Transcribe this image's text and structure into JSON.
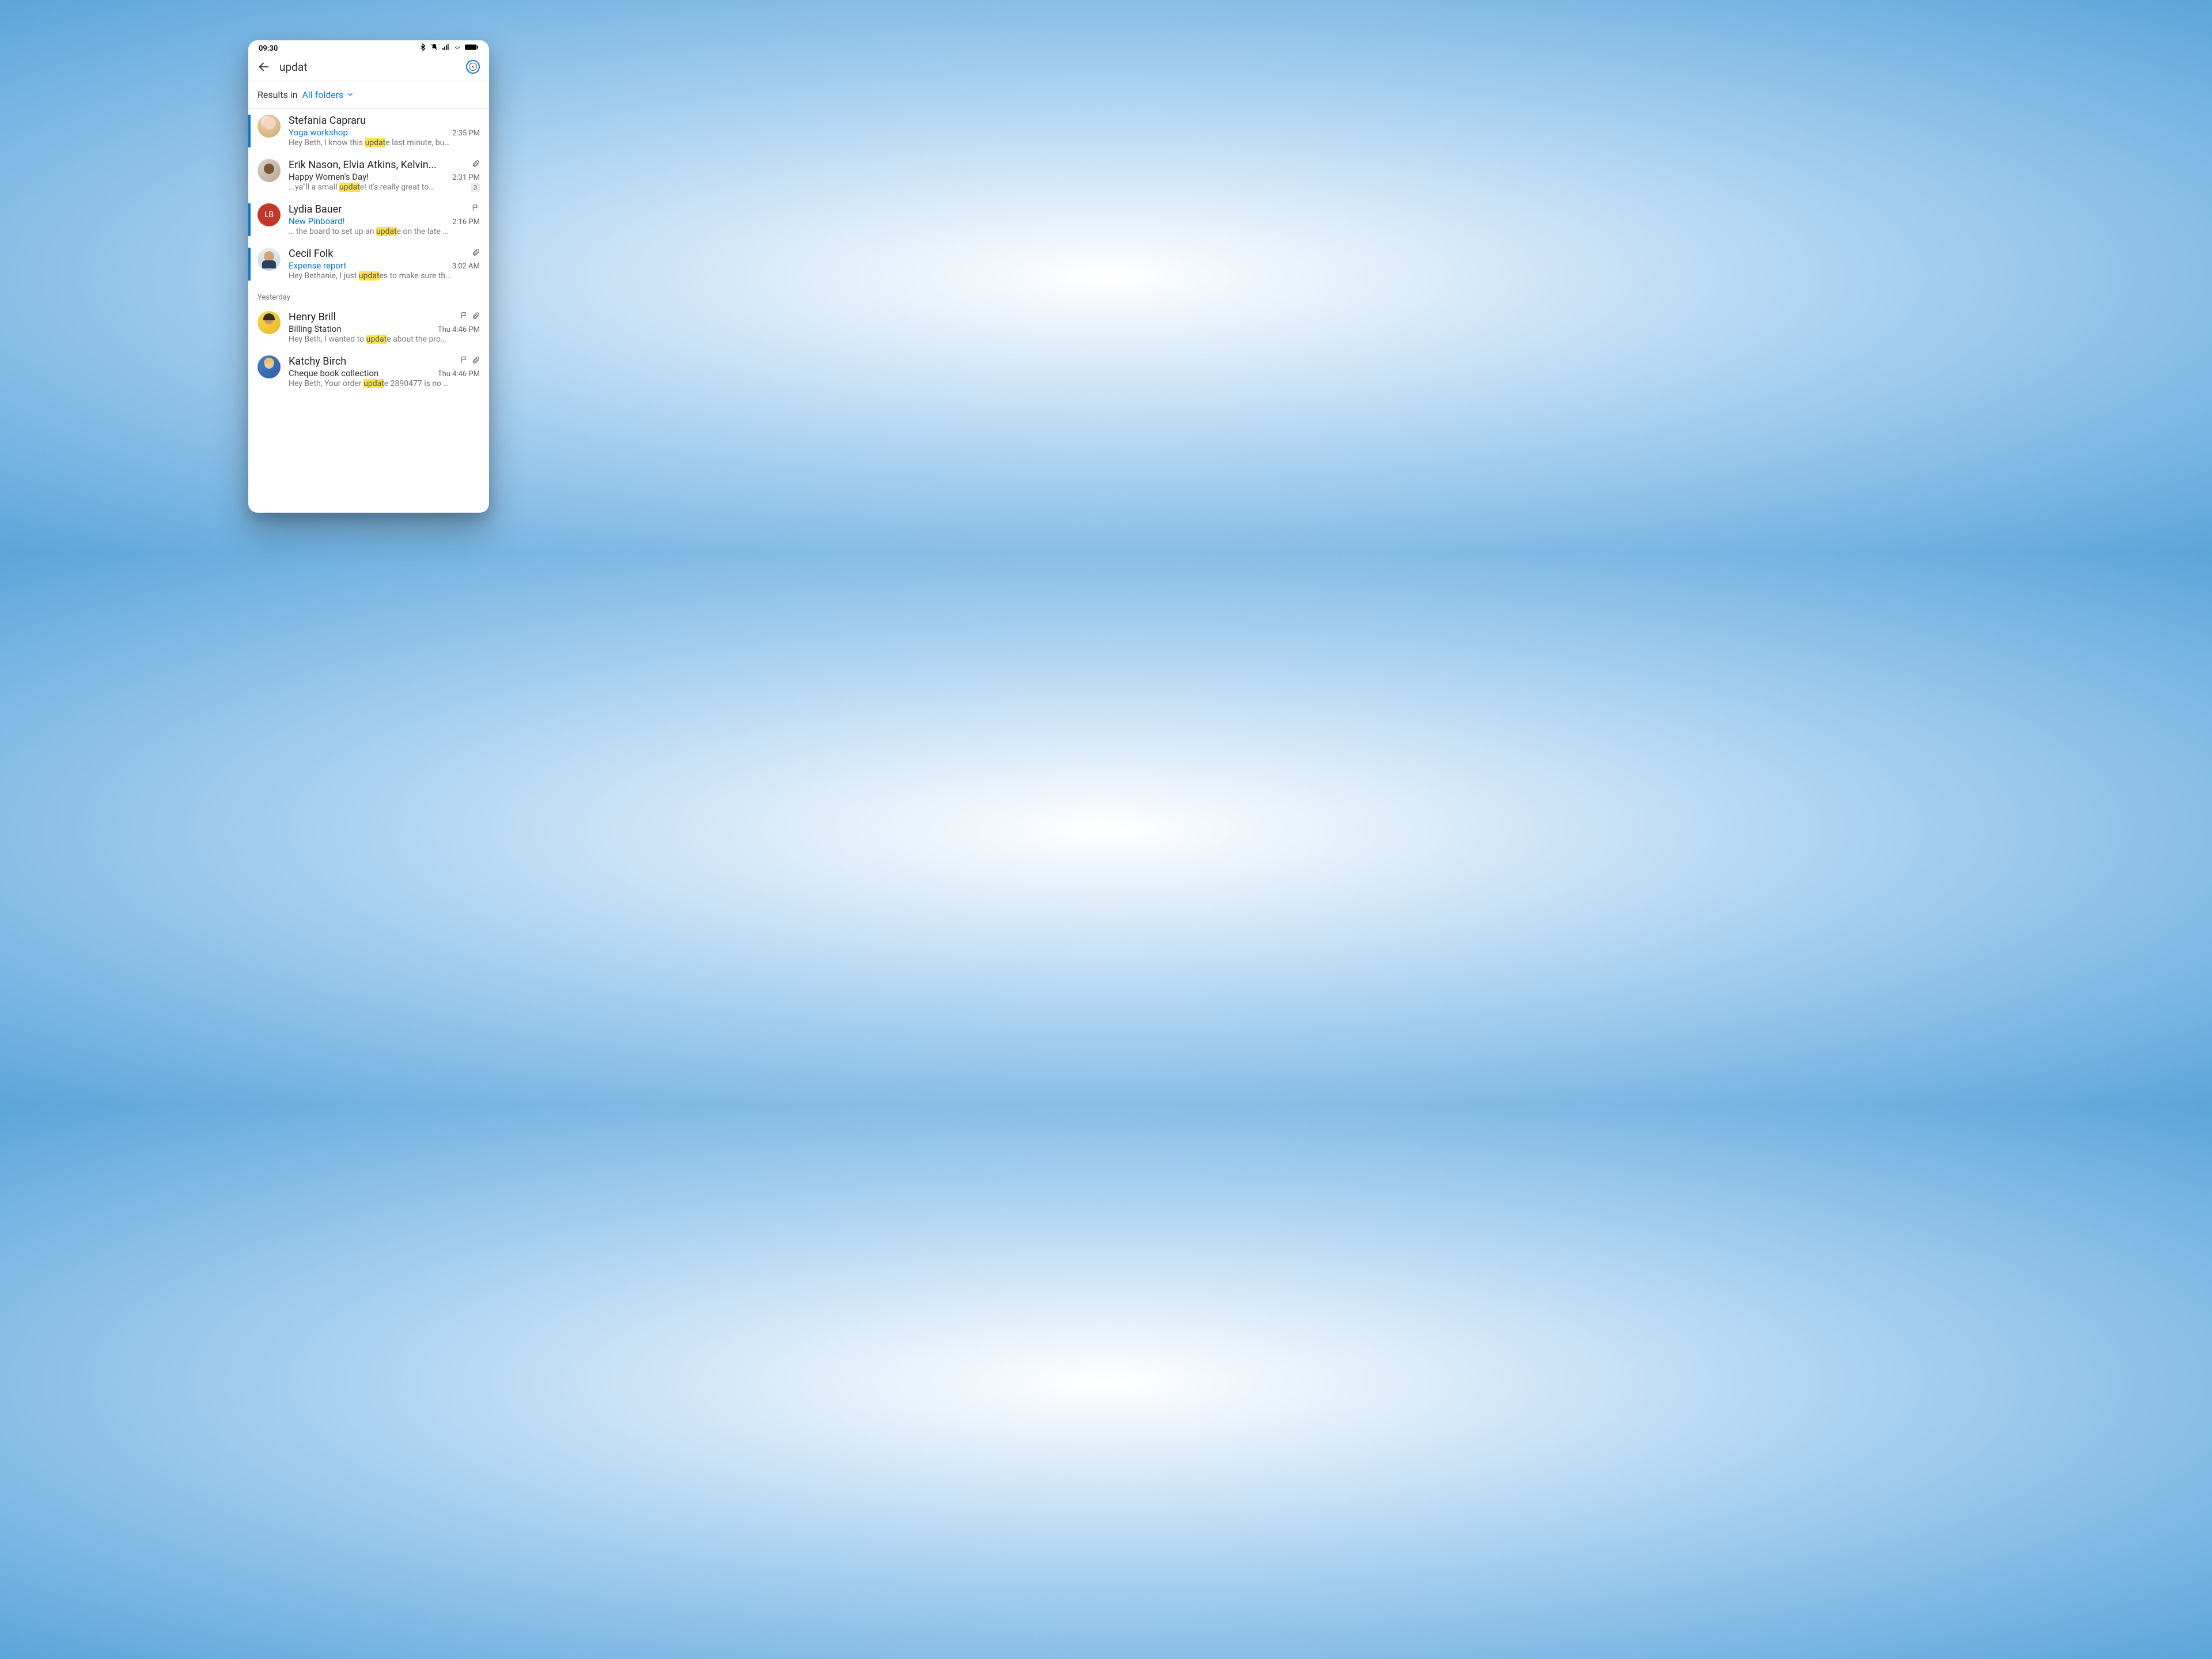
{
  "status": {
    "time": "09:30"
  },
  "search": {
    "query": "updat"
  },
  "filter": {
    "label": "Results in",
    "value": "All folders"
  },
  "sections": [
    {
      "header": null,
      "items": [
        {
          "sender": "Stefania Capraru",
          "subject": "Yoga workshop",
          "time": "2:35 PM",
          "preview_pre": "Hey Beth, I know this ",
          "preview_hl": "updat",
          "preview_post": "e last minute, bu…",
          "unread": true,
          "flag": false,
          "attach": false,
          "badge": null,
          "avatar_class": "av-1",
          "initials": ""
        },
        {
          "sender": "Erik Nason, Elvia Atkins, Kelvin...",
          "subject": "Happy Women's Day!",
          "time": "2:31 PM",
          "preview_pre": "...ya\"ll a small ",
          "preview_hl": "updat",
          "preview_post": "e! it's really great to…",
          "unread": false,
          "flag": false,
          "attach": true,
          "badge": "3",
          "avatar_class": "av-2",
          "initials": ""
        },
        {
          "sender": "Lydia Bauer",
          "subject": "New Pinboard!",
          "time": "2:16 PM",
          "preview_pre": "… the board to set up an ",
          "preview_hl": "updat",
          "preview_post": "e on the late …",
          "unread": true,
          "flag": true,
          "attach": false,
          "badge": null,
          "avatar_class": "av-3",
          "initials": "LB"
        },
        {
          "sender": "Cecil Folk",
          "subject": "Expense report",
          "time": "3:02 AM",
          "preview_pre": "Hey Bethanie, I just ",
          "preview_hl": "updat",
          "preview_post": "es to make sure th…",
          "unread": true,
          "flag": false,
          "attach": true,
          "badge": null,
          "avatar_class": "av-4",
          "initials": ""
        }
      ]
    },
    {
      "header": "Yesterday",
      "items": [
        {
          "sender": "Henry Brill",
          "subject": "Billing Station",
          "time": "Thu 4:46 PM",
          "preview_pre": "Hey Beth, I wanted to ",
          "preview_hl": "updat",
          "preview_post": "e about the pro…",
          "unread": false,
          "flag": true,
          "attach": true,
          "badge": null,
          "avatar_class": "av-5",
          "initials": ""
        },
        {
          "sender": "Katchy Birch",
          "subject": "Cheque book collection",
          "time": "Thu 4:46 PM",
          "preview_pre": "Hey Beth, Your order ",
          "preview_hl": "updat",
          "preview_post": "e 2890477 is no …",
          "unread": false,
          "flag": true,
          "attach": true,
          "badge": null,
          "avatar_class": "av-6",
          "initials": ""
        }
      ]
    }
  ]
}
